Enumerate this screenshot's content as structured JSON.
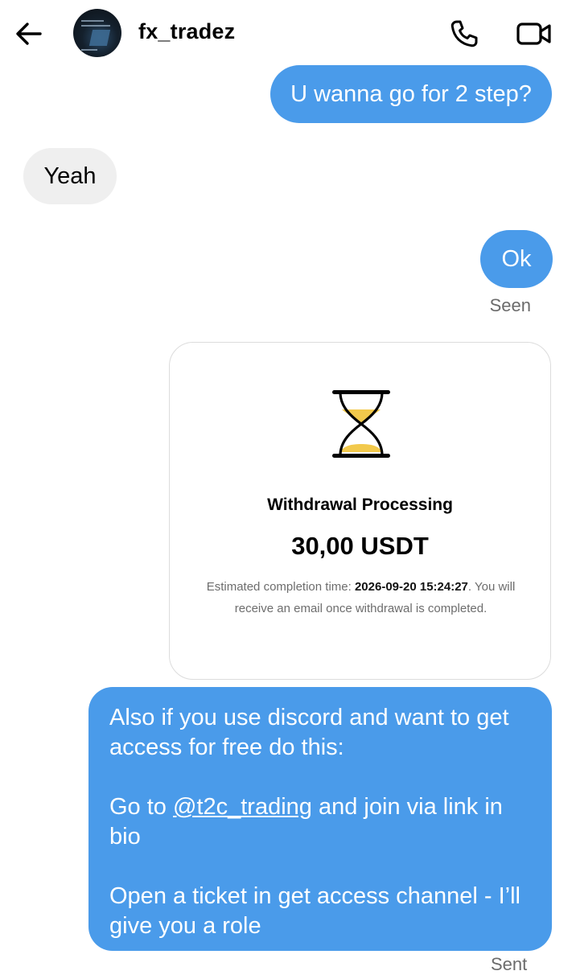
{
  "header": {
    "back_icon": "arrow-left-icon",
    "username": "fx_tradez",
    "call_icon": "phone-icon",
    "video_icon": "video-camera-icon"
  },
  "messages": [
    {
      "direction": "outgoing",
      "text": "U wanna go for 2 step?"
    },
    {
      "direction": "incoming",
      "text": "Yeah"
    },
    {
      "direction": "outgoing",
      "text": "Ok"
    }
  ],
  "seen_label": "Seen",
  "withdrawal_card": {
    "icon": "hourglass-icon",
    "title": "Withdrawal Processing",
    "amount": "30,00 USDT",
    "eta_label": "Estimated completion time:",
    "eta_value": "2026-09-20 15:24:27",
    "eta_suffix": ".",
    "note": "You will receive an email once withdrawal is completed."
  },
  "long_message": {
    "line1": "Also if you use discord and want to get access for free do this:",
    "line2_prefix": "Go to ",
    "line2_mention": "@t2c_trading",
    "line2_suffix": " and join via link in bio",
    "line3": "Open a ticket in get access channel - I’ll give you a role"
  },
  "sent_label": "Sent",
  "colors": {
    "outgoing_bubble": "#4a9bea",
    "incoming_bubble": "#efefef",
    "hourglass_sand": "#f2c94c"
  }
}
